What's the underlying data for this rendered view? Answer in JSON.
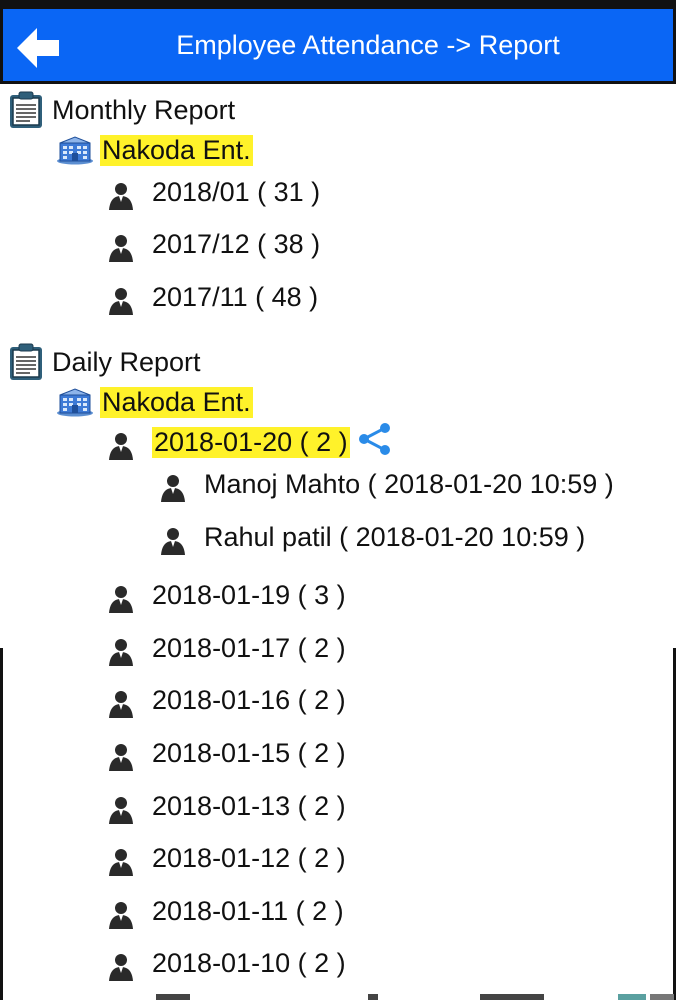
{
  "header": {
    "title": "Employee Attendance -> Report",
    "back_icon": "arrow-left-icon",
    "bar_color": "#0a66f5"
  },
  "highlight_color": "#fff22a",
  "monthly": {
    "label": "Monthly Report",
    "company": "Nakoda Ent.",
    "entries": [
      "2018/01 ( 31 )",
      "2017/12 ( 38 )",
      "2017/11 ( 48 )"
    ]
  },
  "daily": {
    "label": "Daily Report",
    "company": "Nakoda Ent.",
    "selected": "2018-01-20 ( 2 )",
    "employees": [
      "Manoj Mahto ( 2018-01-20 10:59 )",
      "Rahul patil ( 2018-01-20 10:59 )"
    ],
    "entries": [
      "2018-01-19 ( 3 )",
      "2018-01-17 ( 2 )",
      "2018-01-16 ( 2 )",
      "2018-01-15 ( 2 )",
      "2018-01-13 ( 2 )",
      "2018-01-12 ( 2 )",
      "2018-01-11 ( 2 )",
      "2018-01-10 ( 2 )"
    ]
  }
}
